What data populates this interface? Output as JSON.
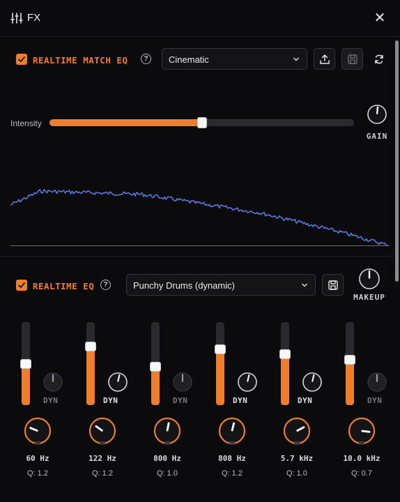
{
  "header": {
    "title": "FX",
    "close_label": "✕"
  },
  "match_eq": {
    "enabled": true,
    "label": "REALTIME MATCH EQ",
    "preset": "Cinematic",
    "intensity_label": "Intensity",
    "intensity": 0.5,
    "gain_label": "GAIN",
    "gain_level": 0.52,
    "spectrum_color": "#5b7fe6"
  },
  "realtime_eq": {
    "enabled": true,
    "label": "REALTIME EQ",
    "preset": "Punchy Drums (dynamic)",
    "makeup_label": "MAKEUP",
    "makeup_level": 0.5,
    "dyn_label": "DYN",
    "bands": [
      {
        "freq": "60 Hz",
        "q": "Q: 1.2",
        "gain": 0.5,
        "dyn": false,
        "freq_pos": 0.25
      },
      {
        "freq": "122 Hz",
        "q": "Q: 1.2",
        "gain": 0.71,
        "dyn": true,
        "freq_pos": 0.3
      },
      {
        "freq": "800 Hz",
        "q": "Q: 1.0",
        "gain": 0.46,
        "dyn": false,
        "freq_pos": 0.54
      },
      {
        "freq": "808 Hz",
        "q": "Q: 1.2",
        "gain": 0.67,
        "dyn": true,
        "freq_pos": 0.55
      },
      {
        "freq": "5.7 kHz",
        "q": "Q: 1.0",
        "gain": 0.61,
        "dyn": true,
        "freq_pos": 0.73
      },
      {
        "freq": "10.0 kHz",
        "q": "Q: 0.7",
        "gain": 0.55,
        "dyn": false,
        "freq_pos": 0.86
      }
    ]
  },
  "colors": {
    "accent": "#ee7d2c",
    "background": "#0b0b0d",
    "text": "#e6e6e8",
    "dim": "#7a7a7e"
  }
}
